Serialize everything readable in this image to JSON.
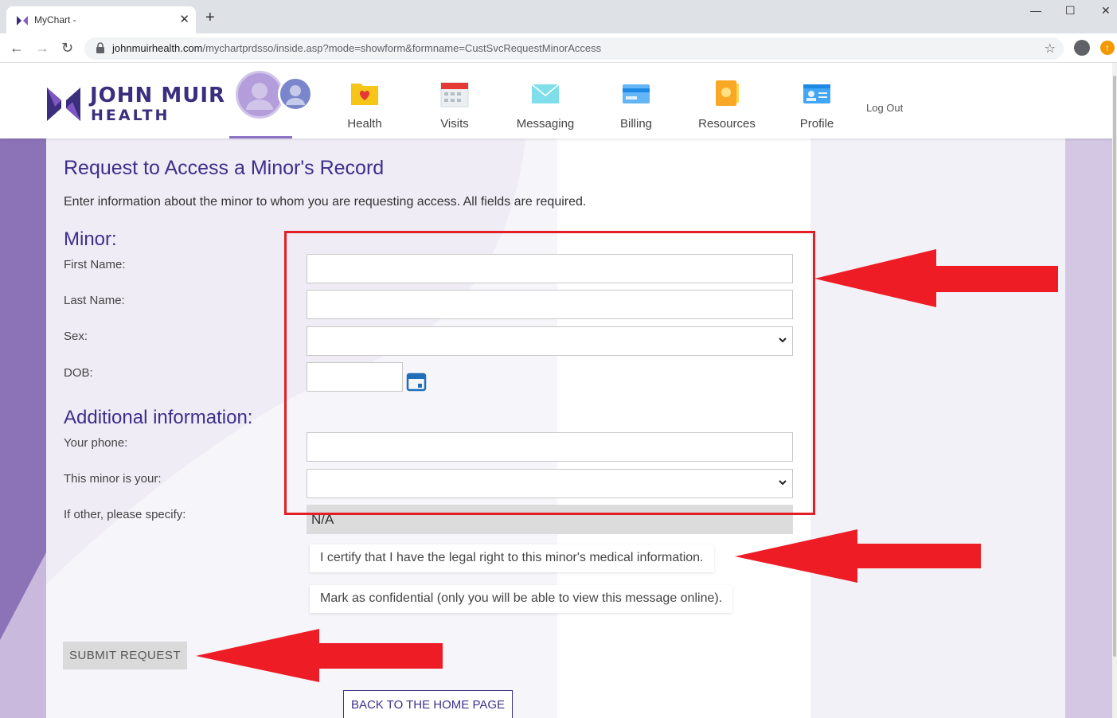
{
  "browser": {
    "tab_title": "MyChart -",
    "url_host": "johnmuirhealth.com",
    "url_path": "/mychartprdsso/inside.asp?mode=showform&formname=CustSvcRequestMinorAccess"
  },
  "header": {
    "logo_line1": "JOHN MUIR",
    "logo_line2": "HEALTH",
    "nav": [
      {
        "label": "Health"
      },
      {
        "label": "Visits"
      },
      {
        "label": "Messaging"
      },
      {
        "label": "Billing"
      },
      {
        "label": "Resources"
      },
      {
        "label": "Profile"
      }
    ],
    "logout": "Log Out"
  },
  "form": {
    "title": "Request to Access a Minor's Record",
    "intro": "Enter information about the minor to whom you are requesting access. All fields are required.",
    "minor_heading": "Minor:",
    "first_name_label": "First Name:",
    "last_name_label": "Last Name:",
    "sex_label": "Sex:",
    "dob_label": "DOB:",
    "additional_heading": "Additional information:",
    "phone_label": "Your phone:",
    "relation_label": "This minor is your:",
    "other_label": "If other, please specify:",
    "other_value": "N/A",
    "certify": "I certify that I have the legal right to this minor's medical information.",
    "confidential": "Mark as confidential (only you will be able to view this message online).",
    "submit": "SUBMIT REQUEST",
    "back": "BACK TO THE HOME PAGE"
  },
  "colors": {
    "brand": "#3d2f8c",
    "annotation": "#e31e24"
  }
}
